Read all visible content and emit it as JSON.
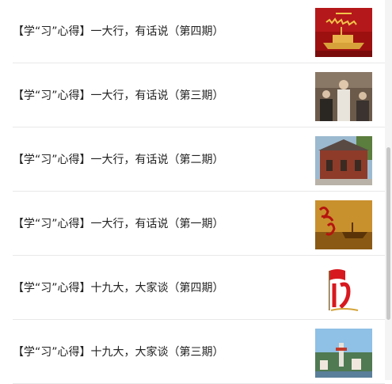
{
  "articles": [
    {
      "title": "【学“习”心得】一大行，有话说（第四期）",
      "thumbnail": "red-boat-image"
    },
    {
      "title": "【学“习”心得】一大行，有话说（第三期）",
      "thumbnail": "historical-figures-photo"
    },
    {
      "title": "【学“习”心得】一大行，有话说（第二期）",
      "thumbnail": "historic-building-photo"
    },
    {
      "title": "【学“习”心得】一大行，有话说（第一期）",
      "thumbnail": "red-boat-calligraphy-image"
    },
    {
      "title": "【学“习”心得】十九大，大家谈（第四期）",
      "thumbnail": "nineteen-party-flag-logo"
    },
    {
      "title": "【学“习”心得】十九大，大家谈（第三期）",
      "thumbnail": "coastal-city-photo"
    }
  ]
}
